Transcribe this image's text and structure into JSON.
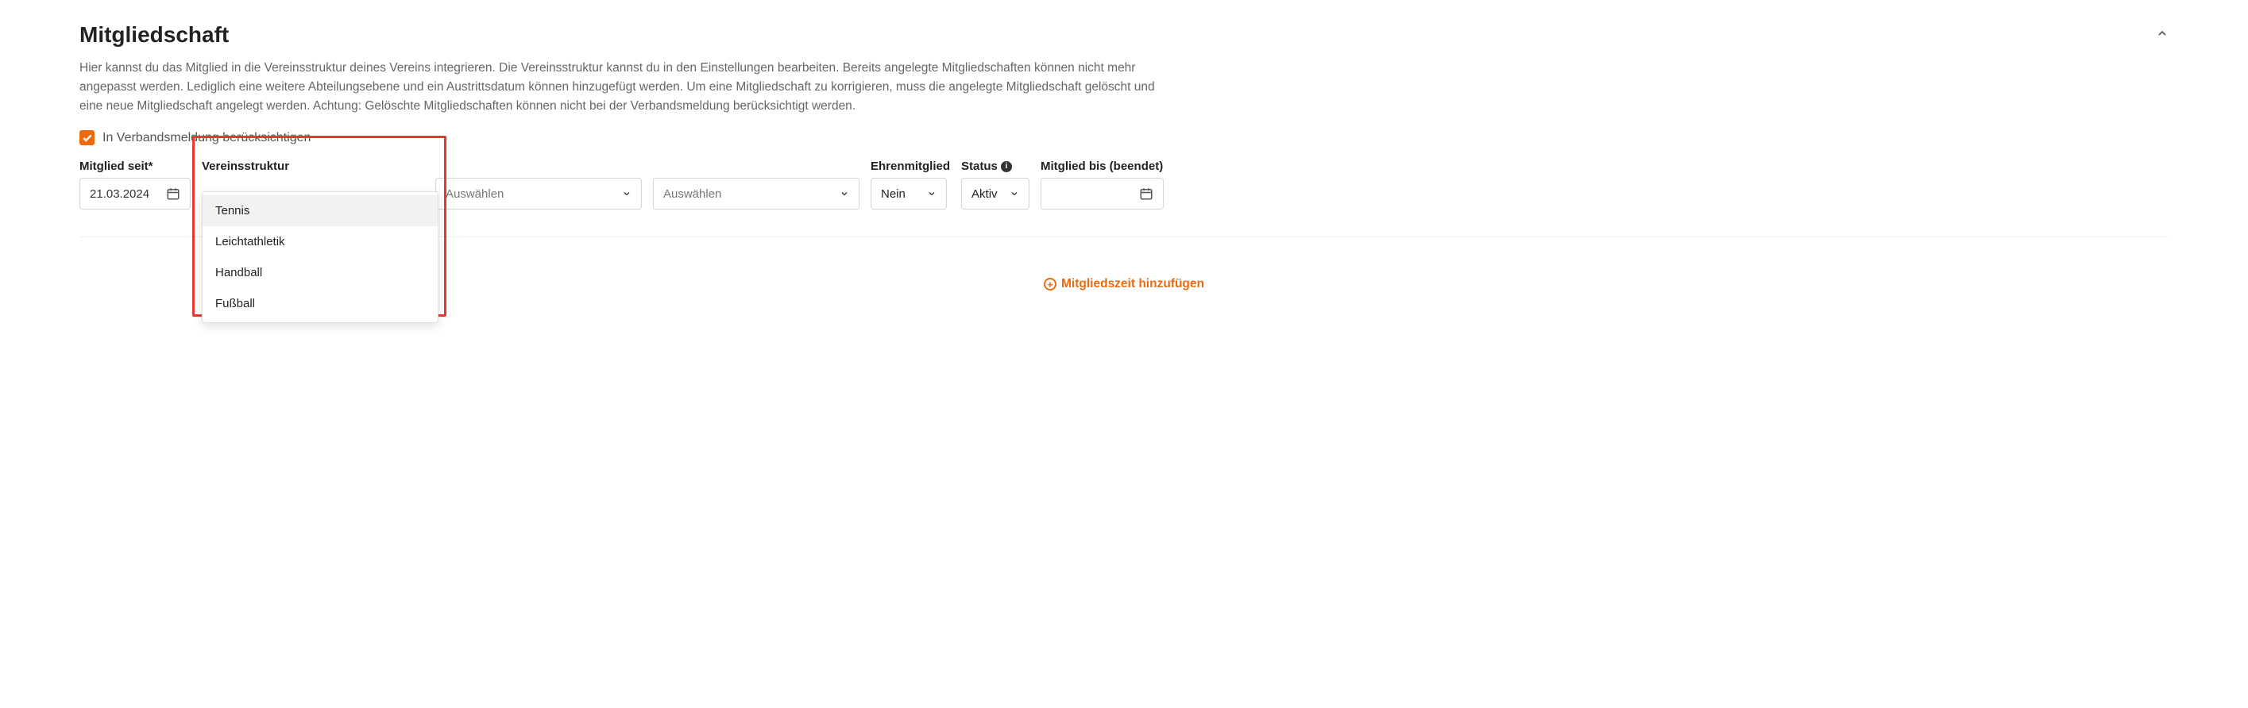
{
  "section": {
    "title": "Mitgliedschaft",
    "description": "Hier kannst du das Mitglied in die Vereinsstruktur deines Vereins integrieren. Die Vereinsstruktur kannst du in den Einstellungen bearbeiten. Bereits angelegte Mitgliedschaften können nicht mehr angepasst werden. Lediglich eine weitere Abteilungsebene und ein Austrittsdatum können hinzugefügt werden. Um eine Mitgliedschaft zu korrigieren, muss die angelegte Mitgliedschaft gelöscht und eine neue Mitgliedschaft angelegt werden. Achtung: Gelöschte Mitgliedschaften können nicht bei der Verbandsmeldung berücksichtigt werden.",
    "verband_checkbox_label": "In Verbandsmeldung berücksichtigen",
    "verband_checked": true
  },
  "fields": {
    "mitglied_seit": {
      "label": "Mitglied seit*",
      "value": "21.03.2024"
    },
    "vereinsstruktur": {
      "label": "Vereinsstruktur",
      "options": [
        "Tennis",
        "Leichtathletik",
        "Handball",
        "Fußball"
      ]
    },
    "select2": {
      "placeholder": "Auswählen"
    },
    "select3": {
      "placeholder": "Auswählen"
    },
    "ehren": {
      "label": "Ehrenmitglied",
      "value": "Nein"
    },
    "status": {
      "label": "Status",
      "value": "Aktiv"
    },
    "mitglied_bis": {
      "label": "Mitglied bis (beendet)",
      "value": ""
    }
  },
  "actions": {
    "add_time": "Mitgliedszeit hinzufügen"
  }
}
